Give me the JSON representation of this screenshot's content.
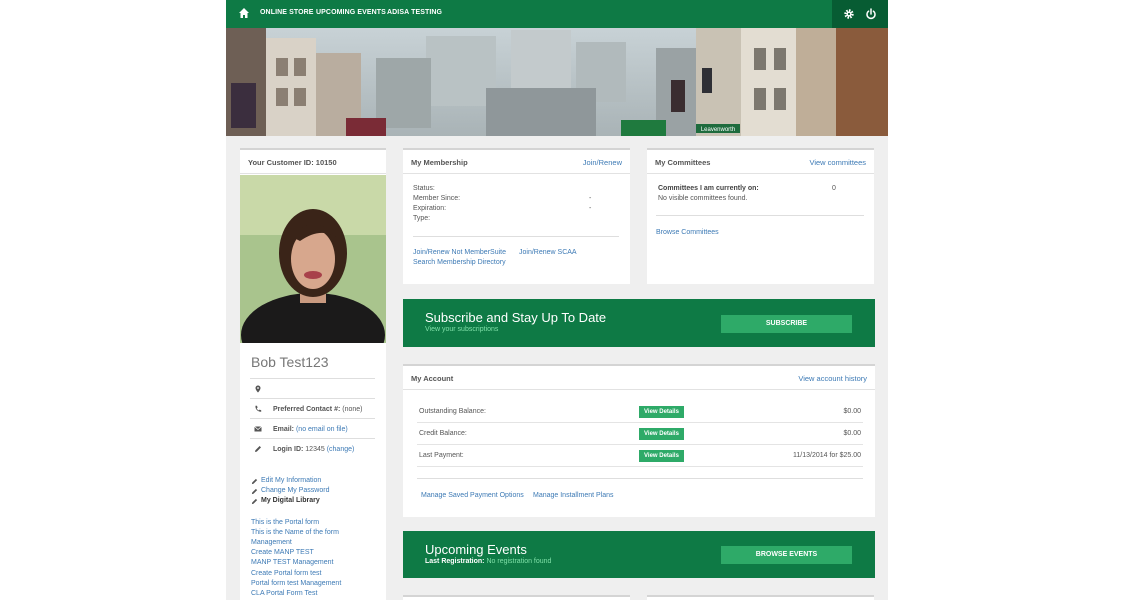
{
  "nav": {
    "items": [
      "ONLINE STORE",
      "UPCOMING EVENTS",
      "ADISA TESTING"
    ]
  },
  "banner": {
    "sign_text": "Leavenworth"
  },
  "profile": {
    "customer_id_label": "Your Customer ID: 10150",
    "name": "Bob Test123",
    "preferred_contact_label": "Preferred Contact #:",
    "preferred_contact_value": "(none)",
    "email_label": "Email:",
    "email_value": "(no email on file)",
    "login_label": "Login ID:",
    "login_value": "12345",
    "login_change": "(change)",
    "actions": [
      "Edit My Information",
      "Change My Password",
      "My Digital Library"
    ],
    "forms": [
      "This is the Portal form",
      "This is the Name of the form",
      "Management",
      "Create MANP TEST",
      "MANP TEST Management",
      "Create Portal form test",
      "Portal form test Management",
      "CLA Portal Form Test"
    ]
  },
  "membership": {
    "title": "My Membership",
    "link": "Join/Renew",
    "fields": [
      {
        "label": "Status:",
        "value": ""
      },
      {
        "label": "Member Since:",
        "value": "-"
      },
      {
        "label": "Expiration:",
        "value": "-"
      },
      {
        "label": "Type:",
        "value": ""
      }
    ],
    "links": [
      "Join/Renew Not MemberSuite",
      "Join/Renew SCAA",
      "Search Membership Directory"
    ]
  },
  "committees": {
    "title": "My Committees",
    "link": "View committees",
    "current_label": "Committees I am currently on:",
    "current_count": "0",
    "none_text": "No visible committees found.",
    "browse": "Browse Committees"
  },
  "subscribe": {
    "title": "Subscribe and Stay Up To Date",
    "sub": "View your subscriptions",
    "button": "SUBSCRIBE"
  },
  "account": {
    "title": "My Account",
    "link": "View account history",
    "rows": [
      {
        "label": "Outstanding Balance:",
        "button": "View Details",
        "amount": "$0.00"
      },
      {
        "label": "Credit Balance:",
        "button": "View Details",
        "amount": "$0.00"
      },
      {
        "label": "Last Payment:",
        "button": "View Details",
        "amount": "11/13/2014 for $25.00"
      }
    ],
    "links": [
      "Manage Saved Payment Options",
      "Manage Installment Plans"
    ]
  },
  "events": {
    "title": "Upcoming Events",
    "last_reg_label": "Last Registration:",
    "last_reg_value": "No registration found",
    "button": "BROWSE EVENTS"
  },
  "colors": {
    "brand_green": "#0e7a45",
    "button_green": "#2eaa68",
    "link_blue": "#3d7ab5"
  }
}
